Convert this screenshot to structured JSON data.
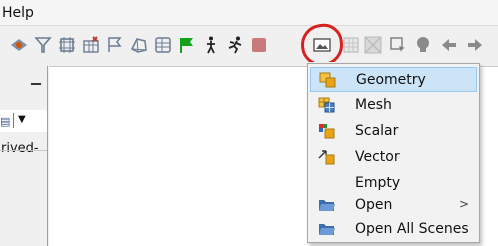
{
  "menubar": {
    "items": [
      {
        "label": "Help"
      }
    ]
  },
  "toolbar": {
    "icons": [
      "scene-icon",
      "filter-icon",
      "crop-icon",
      "chart-delete-icon",
      "flag-outline-icon",
      "polygon-icon",
      "table-icon",
      "green-flag-icon",
      "step-icon",
      "run-icon",
      "stop-icon",
      "new-scene-icon",
      "grid-icon",
      "checker-icon",
      "select-icon",
      "camera-icon",
      "back-arrow-icon",
      "forward-arrow-icon"
    ]
  },
  "left_panel": {
    "derived_text": "rived-"
  },
  "dropdown": {
    "items": [
      {
        "label": "Geometry",
        "icon": "geometry-scene-icon",
        "highlighted": true
      },
      {
        "label": "Mesh",
        "icon": "mesh-scene-icon"
      },
      {
        "label": "Scalar",
        "icon": "scalar-scene-icon"
      },
      {
        "label": "Vector",
        "icon": "vector-scene-icon"
      },
      {
        "label": "Empty",
        "icon": ""
      },
      {
        "label": "Open",
        "icon": "folder-icon",
        "submenu_arrow": ">"
      },
      {
        "label": "Open All Scenes",
        "icon": "folder-icon"
      }
    ]
  },
  "colors": {
    "annotation": "#d8201e",
    "highlight": "#cce4f7",
    "flag_green": "#12a31b",
    "stop_red": "#c77b7b",
    "folder_blue": "#3b6cb0"
  }
}
